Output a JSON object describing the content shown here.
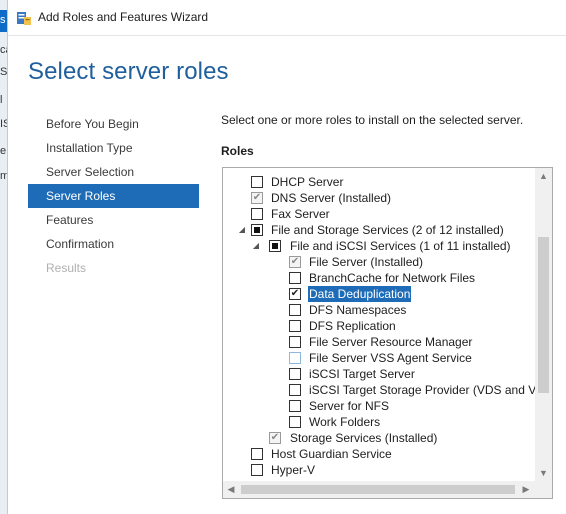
{
  "background_window": {
    "visible_letters": [
      "s",
      "ca",
      "S",
      "l",
      "IS",
      "e",
      "m"
    ]
  },
  "window": {
    "title": "Add Roles and Features Wizard",
    "icon": "server-manager-icon"
  },
  "page": {
    "title": "Select server roles",
    "instructions": "Select one or more roles to install on the selected server.",
    "roles_label": "Roles"
  },
  "nav": {
    "items": [
      {
        "label": "Before You Begin",
        "state": "normal"
      },
      {
        "label": "Installation Type",
        "state": "normal"
      },
      {
        "label": "Server Selection",
        "state": "normal"
      },
      {
        "label": "Server Roles",
        "state": "active"
      },
      {
        "label": "Features",
        "state": "normal"
      },
      {
        "label": "Confirmation",
        "state": "normal"
      },
      {
        "label": "Results",
        "state": "disabled"
      }
    ]
  },
  "roles": [
    {
      "label": "DHCP Server",
      "level": 0,
      "check": "unchecked",
      "expander": "none"
    },
    {
      "label": "DNS Server (Installed)",
      "level": 0,
      "check": "checked-disabled",
      "expander": "none"
    },
    {
      "label": "Fax Server",
      "level": 0,
      "check": "unchecked",
      "expander": "none"
    },
    {
      "label": "File and Storage Services (2 of 12 installed)",
      "level": 0,
      "check": "partial",
      "expander": "expanded"
    },
    {
      "label": "File and iSCSI Services (1 of 11 installed)",
      "level": 1,
      "check": "partial",
      "expander": "expanded"
    },
    {
      "label": "File Server (Installed)",
      "level": 2,
      "check": "checked-disabled",
      "expander": "none"
    },
    {
      "label": "BranchCache for Network Files",
      "level": 2,
      "check": "unchecked",
      "expander": "none"
    },
    {
      "label": "Data Deduplication",
      "level": 2,
      "check": "checked",
      "expander": "none",
      "selected": true
    },
    {
      "label": "DFS Namespaces",
      "level": 2,
      "check": "unchecked",
      "expander": "none"
    },
    {
      "label": "DFS Replication",
      "level": 2,
      "check": "unchecked",
      "expander": "none"
    },
    {
      "label": "File Server Resource Manager",
      "level": 2,
      "check": "unchecked",
      "expander": "none"
    },
    {
      "label": "File Server VSS Agent Service",
      "level": 2,
      "check": "unchecked-light",
      "expander": "none"
    },
    {
      "label": "iSCSI Target Server",
      "level": 2,
      "check": "unchecked",
      "expander": "none"
    },
    {
      "label": "iSCSI Target Storage Provider (VDS and VSS",
      "level": 2,
      "check": "unchecked",
      "expander": "none"
    },
    {
      "label": "Server for NFS",
      "level": 2,
      "check": "unchecked",
      "expander": "none"
    },
    {
      "label": "Work Folders",
      "level": 2,
      "check": "unchecked",
      "expander": "none"
    },
    {
      "label": "Storage Services (Installed)",
      "level": 1,
      "check": "checked-disabled",
      "expander": "none"
    },
    {
      "label": "Host Guardian Service",
      "level": 0,
      "check": "unchecked",
      "expander": "none"
    },
    {
      "label": "Hyper-V",
      "level": 0,
      "check": "unchecked",
      "expander": "none"
    }
  ],
  "colors": {
    "accent": "#1e6cb7",
    "title": "#1f5f9c",
    "disabled_text": "#b0b0b0"
  }
}
